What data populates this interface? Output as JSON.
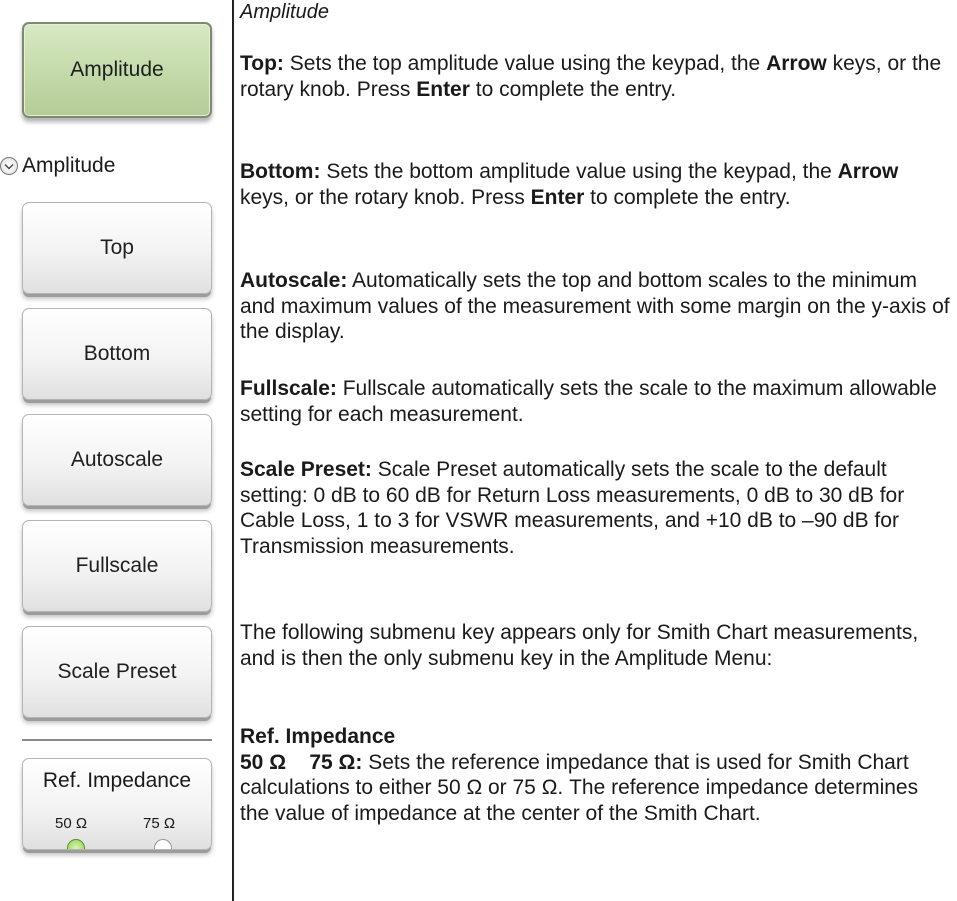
{
  "keys": {
    "amplitude": "Amplitude",
    "menu_label": "Amplitude",
    "top": "Top",
    "bottom": "Bottom",
    "autoscale": "Autoscale",
    "fullscale": "Fullscale",
    "scale_preset": "Scale Preset",
    "ref_impedance": {
      "title": "Ref. Impedance",
      "option_a": "50 Ω",
      "option_b": "75 Ω",
      "selected": "50 Ω"
    },
    "chevron_icon": "chevron-down-icon"
  },
  "text": {
    "heading": "Amplitude",
    "top": {
      "term": "Top:",
      "s1": "  Sets the top amplitude value using the keypad, the ",
      "b1": "Arrow",
      "s2": " keys, or the rotary knob. Press ",
      "b2": "Enter",
      "s3": " to complete the entry."
    },
    "bottom": {
      "term": "Bottom:",
      "s1": "  Sets the bottom amplitude value using the keypad, the ",
      "b1": "Arrow",
      "s2": " keys, or the rotary knob. Press ",
      "b2": "Enter",
      "s3": " to complete the entry."
    },
    "autoscale": {
      "term": "Autoscale:",
      "s1": "  Automatically sets the top and bottom scales to the minimum and maximum values of the measurement with some margin on the y-axis of the display."
    },
    "fullscale": {
      "term": "Fullscale:",
      "s1": "  Fullscale automatically sets the scale to the maximum allowable setting for each measurement."
    },
    "scale_preset": {
      "term": "Scale Preset:",
      "s1": "  Scale Preset automatically sets the scale to the default setting:  0 dB to 60 dB for Return Loss measurements, 0 dB to 30 dB for Cable Loss, 1 to 3 for VSWR measurements, and +10 dB to –90 dB for Transmission measurements."
    },
    "submenu_note": "The following submenu key appears only for Smith Chart measurements, and is then the only submenu key in the Amplitude Menu:",
    "ref_impedance": {
      "term": "Ref. Impedance",
      "options": "50 Ω    75 Ω:",
      "s1": " Sets the reference impedance that is used for Smith Chart calculations to either 50 Ω or 75 Ω. The reference impedance determines the value of impedance at the center of the Smith Chart."
    }
  }
}
